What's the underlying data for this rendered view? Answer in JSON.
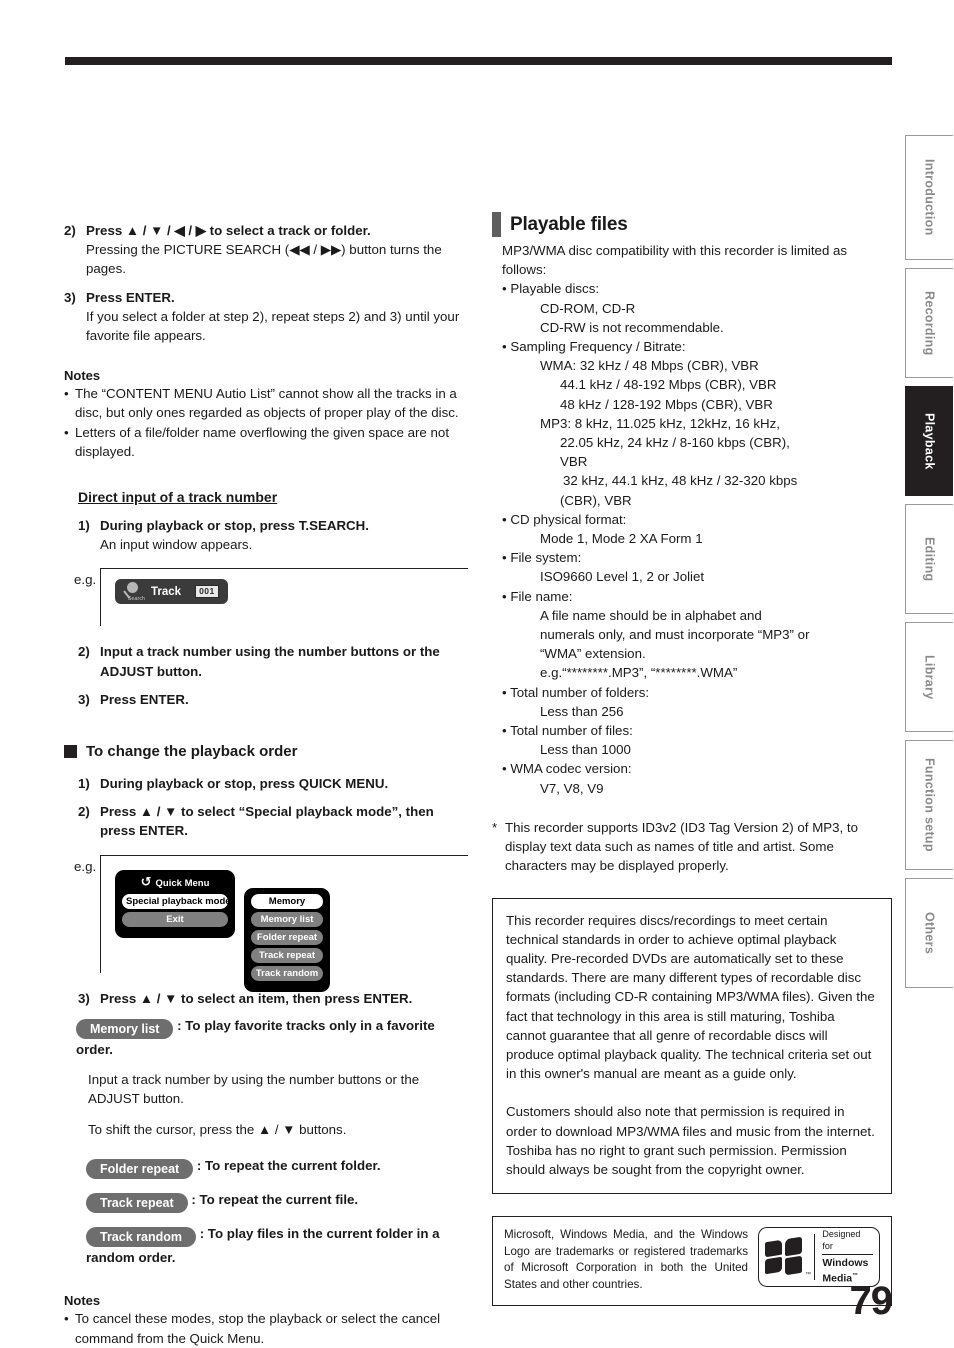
{
  "page": {
    "number": "79"
  },
  "side_tabs": [
    {
      "label": "Introduction",
      "active": false
    },
    {
      "label": "Recording",
      "active": false
    },
    {
      "label": "Playback",
      "active": true
    },
    {
      "label": "Editing",
      "active": false
    },
    {
      "label": "Library",
      "active": false
    },
    {
      "label": "Function setup",
      "active": false
    },
    {
      "label": "Others",
      "active": false
    }
  ],
  "left": {
    "step2": {
      "num": "2)",
      "heading": "Press ▲ / ▼ / ◀ / ▶ to select a track or folder.",
      "body": "Pressing the PICTURE SEARCH (◀◀ / ▶▶) button turns the pages."
    },
    "step3": {
      "num": "3)",
      "heading": "Press ENTER.",
      "body": "If you select a folder at step 2), repeat steps 2) and 3) until your favorite file appears."
    },
    "notes1": {
      "title": "Notes",
      "items": [
        "The “CONTENT MENU Autio List” cannot show all the tracks in a disc, but only ones regarded as objects of proper play of the disc.",
        "Letters of a file/folder name overflowing the given space are not displayed."
      ]
    },
    "direct_input": {
      "heading": "Direct input of a track number",
      "step1": {
        "num": "1)",
        "heading": "During playback or stop, press T.SEARCH.",
        "body": "An input window appears."
      },
      "eg_label": "e.g.",
      "osd": {
        "icon_label": "Search",
        "track_label": "Track",
        "number": "001"
      },
      "step2": {
        "num": "2)",
        "heading": "Input a track number using the number buttons or the ADJUST button."
      },
      "step3": {
        "num": "3)",
        "heading": "Press ENTER."
      }
    },
    "playback_order": {
      "heading": "To change the playback order",
      "step1": {
        "num": "1)",
        "heading": "During playback or stop, press QUICK MENU."
      },
      "step2": {
        "num": "2)",
        "heading": "Press ▲ / ▼ to select “Special playback mode”, then press ENTER."
      },
      "eg_label": "e.g.",
      "quick_menu": {
        "title": "Quick Menu",
        "items": [
          {
            "label": "Special playback mode",
            "selected": true
          },
          {
            "label": "Exit",
            "selected": false
          }
        ]
      },
      "submenu": {
        "items": [
          {
            "label": "Memory",
            "selected": true
          },
          {
            "label": "Memory list",
            "selected": false
          },
          {
            "label": "Folder repeat",
            "selected": false
          },
          {
            "label": "Track repeat",
            "selected": false
          },
          {
            "label": "Track random",
            "selected": false
          }
        ]
      },
      "step3": {
        "num": "3)",
        "heading": "Press ▲ / ▼ to select an item, then press ENTER."
      },
      "memory_list": {
        "pill": "Memory list",
        "desc": ": To play favorite tracks only in a favorite order.",
        "body1": "Input a track number by using the number buttons or the ADJUST button.",
        "body2": "To shift the cursor, press the ▲ / ▼ buttons."
      },
      "modes": [
        {
          "pill": "Folder repeat",
          "desc": ": To repeat the current folder."
        },
        {
          "pill": "Track repeat",
          "desc": ": To repeat the current file."
        },
        {
          "pill": "Track random",
          "desc": ": To play files in the current folder in a random order."
        }
      ]
    },
    "notes2": {
      "title": "Notes",
      "items": [
        "To cancel these modes, stop the playback or select the cancel command from the Quick Menu."
      ]
    }
  },
  "right": {
    "section_title": "Playable files",
    "intro": "MP3/WMA disc compatibility with this recorder is limited as follows:",
    "specs": [
      {
        "bullet": "• Playable discs:",
        "lines": [
          {
            "text": "CD-ROM, CD-R",
            "indent": 1
          },
          {
            "text": "CD-RW is not recommendable.",
            "indent": 1
          }
        ]
      },
      {
        "bullet": "• Sampling Frequency / Bitrate:",
        "lines": [
          {
            "text": "WMA: 32 kHz / 48 Mbps (CBR), VBR",
            "indent": 1
          },
          {
            "text": "44.1 kHz / 48-192 Mbps (CBR), VBR",
            "indent": 2
          },
          {
            "text": "48 kHz / 128-192 Mbps (CBR), VBR",
            "indent": 2
          },
          {
            "text": "MP3:  8 kHz, 11.025 kHz, 12kHz, 16 kHz,",
            "indent": 1
          },
          {
            "text": "22.05 kHz, 24 kHz / 8-160 kbps (CBR),",
            "indent": 2
          },
          {
            "text": "VBR",
            "indent": 2
          },
          {
            "text": "32 kHz, 44.1 kHz, 48 kHz / 32-320 kbps",
            "indent": 2
          },
          {
            "text": "(CBR), VBR",
            "indent": 2
          }
        ]
      },
      {
        "bullet": "• CD physical format:",
        "lines": [
          {
            "text": "Mode 1, Mode 2 XA Form 1",
            "indent": 1
          }
        ]
      },
      {
        "bullet": "• File system:",
        "lines": [
          {
            "text": "ISO9660 Level 1, 2 or Joliet",
            "indent": 1
          }
        ]
      },
      {
        "bullet": "• File name:",
        "lines": [
          {
            "text": "A file name should be in alphabet and",
            "indent": 1
          },
          {
            "text": "numerals only, and must incorporate “MP3” or",
            "indent": 1
          },
          {
            "text": "“WMA” extension.",
            "indent": 1
          },
          {
            "text": "e.g.“********.MP3”, “********.WMA”",
            "indent": 1
          }
        ]
      },
      {
        "bullet": "• Total number of folders:",
        "lines": [
          {
            "text": "Less than 256",
            "indent": 1
          }
        ]
      },
      {
        "bullet": "• Total number of files:",
        "lines": [
          {
            "text": "Less than 1000",
            "indent": 1
          }
        ]
      },
      {
        "bullet": "• WMA codec version:",
        "lines": [
          {
            "text": "V7, V8, V9",
            "indent": 1
          }
        ]
      }
    ],
    "star_note": {
      "marker": "*",
      "text": "This recorder supports ID3v2 (ID3 Tag Version 2) of MP3, to display text data such as names of title and artist. Some characters may be displayed properly."
    },
    "boxed": {
      "para1": "This recorder requires discs/recordings to meet certain technical standards in order to achieve optimal playback quality.  Pre-recorded DVDs are automatically set to these standards. There are many different types of recordable disc formats (including CD-R containing MP3/WMA files).  Given the fact that technology in this area is still maturing, Toshiba cannot guarantee that all genre of recordable discs will produce optimal playback quality.  The technical criteria set out in this owner's manual are meant as a guide only.",
      "para2": "Customers should also note that permission is required in order to download MP3/WMA files and music from the internet.  Toshiba has no right to grant such permission. Permission should always be sought from the copyright owner."
    },
    "ms_notice": {
      "text": "Microsoft, Windows Media, and the Windows Logo are trademarks or registered trademarks of Microsoft Corporation in both the United States and other countries.",
      "logo": {
        "line1": "Designed for",
        "line2": "Windows",
        "line3": "Media",
        "tm": "™"
      }
    }
  }
}
